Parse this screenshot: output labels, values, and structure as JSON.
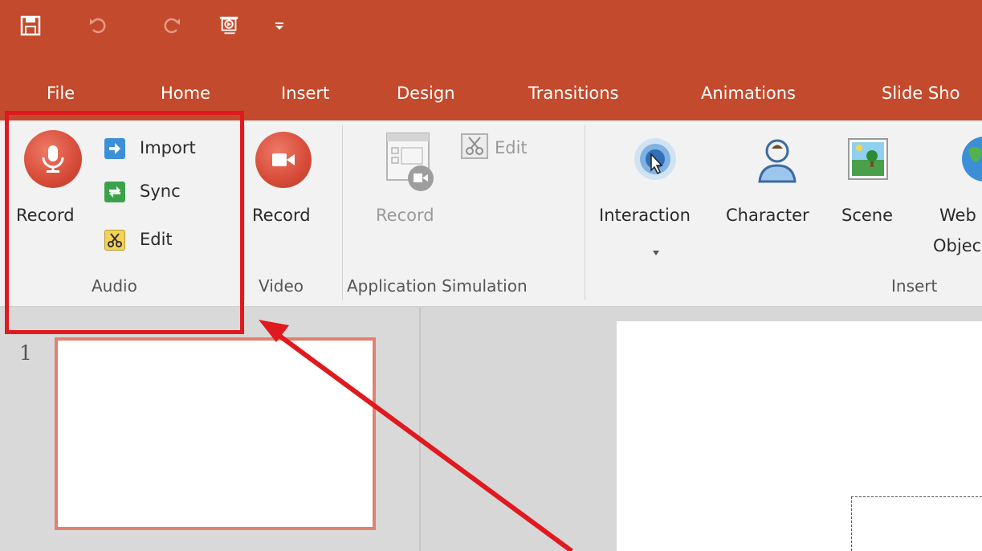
{
  "quick_access": {
    "icons": [
      "save-icon",
      "undo-icon",
      "redo-icon",
      "preview-icon",
      "customize-qat-icon"
    ]
  },
  "tabs": [
    {
      "label": "File"
    },
    {
      "label": "Home"
    },
    {
      "label": "Insert"
    },
    {
      "label": "Design"
    },
    {
      "label": "Transitions"
    },
    {
      "label": "Animations"
    },
    {
      "label": "Slide Sho"
    }
  ],
  "ribbon": {
    "audio": {
      "record_label": "Record",
      "import_label": "Import",
      "sync_label": "Sync",
      "edit_label": "Edit",
      "group_label": "Audio"
    },
    "video": {
      "record_label": "Record",
      "group_label": "Video"
    },
    "app_sim": {
      "record_label": "Record",
      "edit_label": "Edit",
      "group_label": "Application Simulation"
    },
    "insert": {
      "interaction_label": "Interaction",
      "character_label": "Character",
      "scene_label": "Scene",
      "web_object_line1": "Web",
      "web_object_line2": "Objec",
      "group_label": "Insert"
    }
  },
  "slides_pane": {
    "slide_number": "1"
  },
  "colors": {
    "title_bar": "#c34a2c",
    "ribbon_bg": "#f2f2f2",
    "record_button": "#d64b38",
    "highlight": "#e0191f",
    "thumb_selected_border": "#e0826e"
  }
}
